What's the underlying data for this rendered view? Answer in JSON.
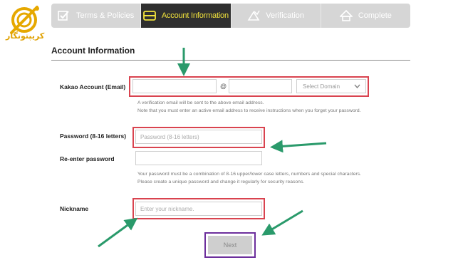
{
  "watermark": {
    "text": "کریپتونگار"
  },
  "steps": [
    {
      "label": "Terms & Policies",
      "icon": "checkbox-icon",
      "active": false
    },
    {
      "label": "Account Information",
      "icon": "card-icon",
      "active": true
    },
    {
      "label": "Verification",
      "icon": "triangle-icon",
      "active": false
    },
    {
      "label": "Complete",
      "icon": "house-icon",
      "active": false
    }
  ],
  "page_title": "Account Information",
  "email": {
    "label": "Kakao Account (Email)",
    "at_symbol": "@",
    "domain_placeholder": "Select Domain",
    "help": [
      "A verification email will be sent to the above email address.",
      "Note that you must enter an active email address to receive instructions when you forget your password."
    ]
  },
  "password": {
    "label": "Password (8-16 letters)",
    "placeholder": "Password (8-16 letters)",
    "reenter_label": "Re-enter password",
    "help": [
      "Your password must be a combination of 8-16 upper/lower case letters, numbers and special characters.",
      "Please create a unique password and change it regularly for security reasons."
    ]
  },
  "nickname": {
    "label": "Nickname",
    "placeholder": "Enter your nickname."
  },
  "next_label": "Next",
  "colors": {
    "highlight": "#d9434f",
    "next_highlight": "#6c2f9c",
    "arrow": "#2a9a6b",
    "active_step_bg": "#2f2f2f",
    "active_step_text": "#f3e43c"
  }
}
